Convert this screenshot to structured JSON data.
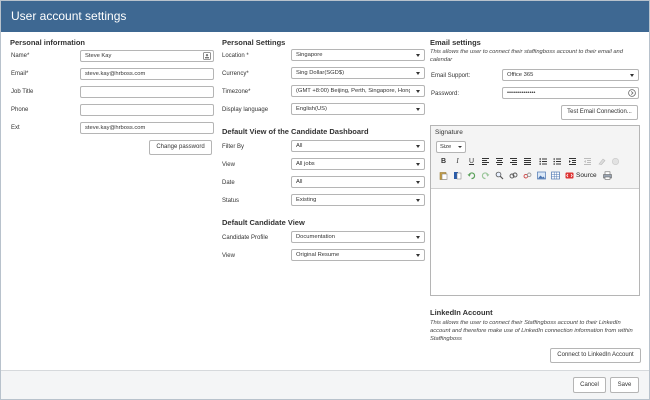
{
  "window": {
    "title": "User account settings"
  },
  "personal_info": {
    "heading": "Personal information",
    "name_label": "Name*",
    "name_value": "Steve Kay",
    "email_label": "Email*",
    "email_value": "steve.kay@hrboss.com",
    "job_title_label": "Job Title",
    "job_title_value": "",
    "phone_label": "Phone",
    "phone_value": "",
    "ext_label": "Ext",
    "ext_value": "steve.kay@hrboss.com",
    "change_password_label": "Change password"
  },
  "personal_settings": {
    "heading": "Personal Settings",
    "location_label": "Location *",
    "location_value": "Singapore",
    "currency_label": "Currency*",
    "currency_value": "Sing Dollar(SGD$)",
    "timezone_label": "Timezone*",
    "timezone_value": "(GMT +8:00) Beijing, Perth, Singapore, Hong",
    "language_label": "Display language",
    "language_value": "English(US)"
  },
  "dashboard_view": {
    "heading": "Default View of the Candidate Dashboard",
    "filter_label": "Filter By",
    "filter_value": "All",
    "view_label": "View",
    "view_value": "All jobs",
    "date_label": "Date",
    "date_value": "All",
    "status_label": "Status",
    "status_value": "Existing"
  },
  "candidate_view": {
    "heading": "Default Candidate View",
    "profile_label": "Candidate Profile",
    "profile_value": "Documentation",
    "view_label": "View",
    "view_value": "Original Resume"
  },
  "email_settings": {
    "heading": "Email settings",
    "description": "This allows the user to connect their staffingboss account to their email and calendar",
    "support_label": "Email Support:",
    "support_value": "Office 365",
    "password_label": "Password:",
    "password_value": "••••••••••••••",
    "test_button_label": "Test Email Connection..."
  },
  "signature": {
    "label": "Signature",
    "size_label": "Size",
    "toolbar": {
      "bold": "B",
      "italic": "I",
      "underline": "U",
      "source_label": "Source"
    }
  },
  "linkedin": {
    "heading": "LinkedIn Account",
    "description": "This allows the user to connect their Staffingboss account to their LinkedIn account and therefore make use of LinkedIn connection information from within Staffingboss",
    "connect_label": "Connect to LinkedIn Account"
  },
  "footer": {
    "cancel_label": "Cancel",
    "save_label": "Save"
  },
  "colors": {
    "titlebar": "#3e6892",
    "footer": "#f4f5f6"
  }
}
